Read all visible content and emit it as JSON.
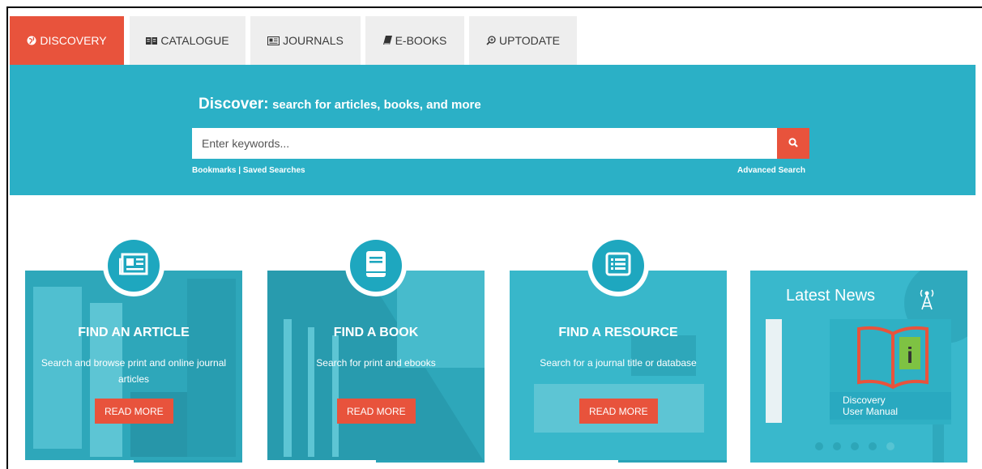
{
  "tabs": [
    {
      "label": "DISCOVERY",
      "icon": "globe-icon",
      "active": true
    },
    {
      "label": "CATALOGUE",
      "icon": "open-book-icon",
      "active": false
    },
    {
      "label": "JOURNALS",
      "icon": "newspaper-icon",
      "active": false
    },
    {
      "label": "E-BOOKS",
      "icon": "book-icon",
      "active": false
    },
    {
      "label": "UPTODATE",
      "icon": "zoom-icon",
      "active": false
    }
  ],
  "search": {
    "title_bold": "Discover:",
    "title_rest": "search for articles, books, and more",
    "placeholder": "Enter keywords...",
    "value": "",
    "bookmarks": "Bookmarks",
    "separator": "|",
    "saved_searches": "Saved Searches",
    "advanced": "Advanced Search"
  },
  "cards": [
    {
      "title": "FIND AN ARTICLE",
      "desc": "Search and browse print and online journal articles",
      "button": "READ MORE",
      "icon": "newspaper-icon"
    },
    {
      "title": "FIND A BOOK",
      "desc": "Search for print and ebooks",
      "button": "READ MORE",
      "icon": "book-icon"
    },
    {
      "title": "FIND A RESOURCE",
      "desc": "Search for a journal title or database",
      "button": "READ MORE",
      "icon": "list-icon"
    }
  ],
  "news": {
    "title": "Latest News",
    "slide_caption_line1": "Discovery",
    "slide_caption_line2": "User Manual",
    "slide_count": 5,
    "active_slide": 5
  },
  "colors": {
    "accent": "#e8533c",
    "band": "#2bb0c6",
    "tab_bg": "#eeeeee"
  }
}
